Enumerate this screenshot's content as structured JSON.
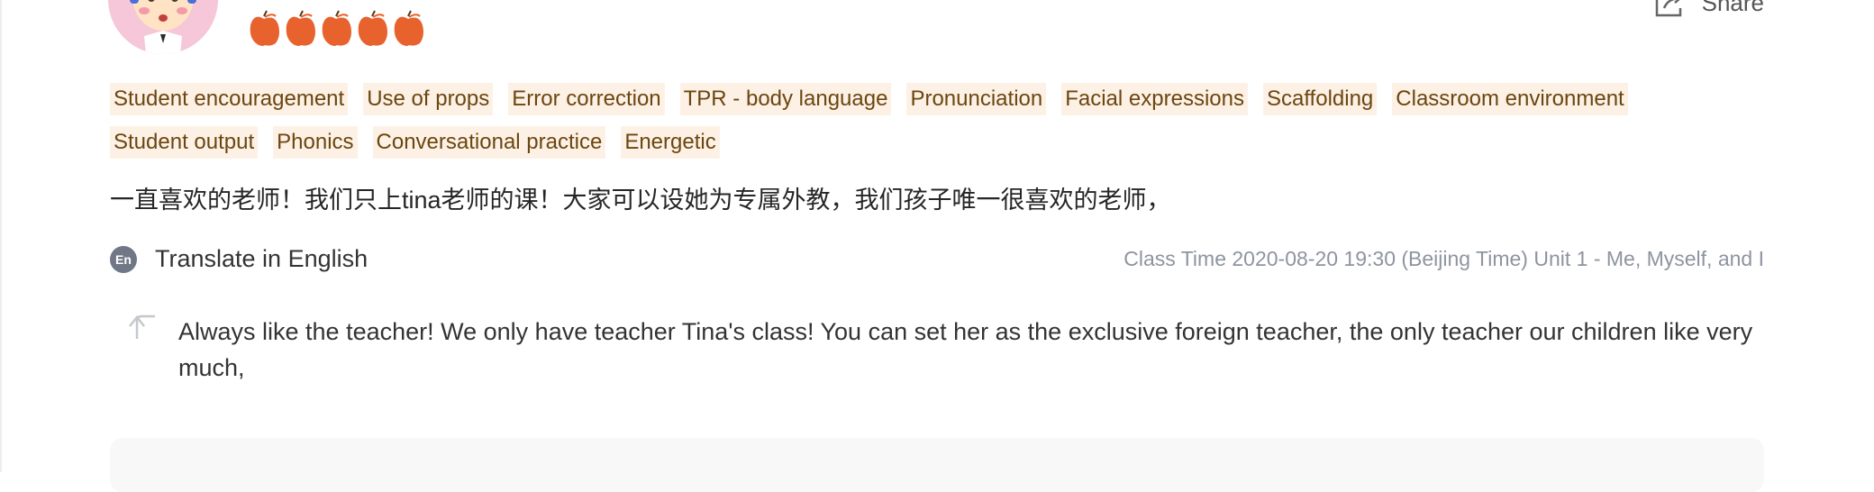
{
  "header": {
    "share_label": "Share",
    "rating": {
      "value": 5,
      "max": 5,
      "icon": "apple-icon",
      "color": "#e8622d"
    }
  },
  "tags": {
    "row1": [
      "Student encouragement",
      "Use of props",
      "Error correction",
      "TPR - body language",
      "Pronunciation",
      "Facial expressions",
      "Scaffolding",
      "Classroom environment"
    ],
    "row2": [
      "Student output",
      "Phonics",
      "Conversational practice",
      "Energetic"
    ]
  },
  "review": {
    "original_text": "一直喜欢的老师！我们只上tina老师的课！大家可以设她为专属外教，我们孩子唯一很喜欢的老师，",
    "translate_badge": "En",
    "translate_label": "Translate in English",
    "class_info": "Class Time 2020-08-20 19:30 (Beijing Time) Unit 1 - Me, Myself, and I",
    "translation": "Always like the teacher! We only have teacher Tina's class! You can set her as the exclusive foreign teacher, the only teacher our children like very much,"
  },
  "colors": {
    "tag_bg": "#fdf1e5",
    "tag_text": "#6b4610",
    "meta_text": "#8e94a0",
    "badge_bg": "#707786"
  }
}
